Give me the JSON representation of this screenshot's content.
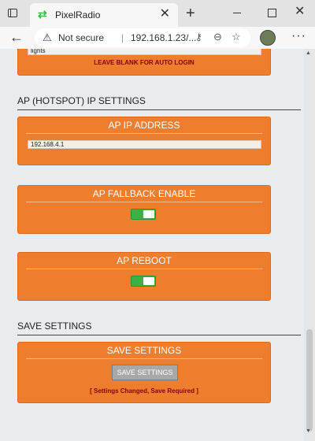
{
  "browser": {
    "tab_title": "PixelRadio",
    "tab_close": "✕",
    "new_tab": "+",
    "win_close": "✕",
    "not_secure": "Not secure",
    "url_sep": "|",
    "url": "192.168.1.23/...",
    "warning_glyph": "⚠",
    "favicon_glyph": "⇄",
    "back_glyph": "←",
    "key_glyph": "⚷",
    "zoom_glyph": "⊖",
    "fav_glyph": "☆",
    "menu_glyph": "···"
  },
  "login_card": {
    "input_value": "lights",
    "hint": "LEAVE BLANK FOR AUTO LOGIN"
  },
  "ap_section": {
    "heading": "AP (HOTSPOT) IP SETTINGS",
    "ip_card": {
      "title": "AP IP ADDRESS",
      "value": "192.168.4.1"
    },
    "fallback_card": {
      "title": "AP FALLBACK ENABLE",
      "enabled": true
    },
    "reboot_card": {
      "title": "AP REBOOT",
      "enabled": true
    }
  },
  "save_section": {
    "heading": "SAVE SETTINGS",
    "card_title": "SAVE SETTINGS",
    "button_label": "SAVE SETTINGS",
    "status": "[ Settings Changed, Save Required ]"
  },
  "scrollbar": {
    "up_glyph": "▲",
    "down_glyph": "▼"
  },
  "colors": {
    "card_orange": "#ee7e2e",
    "toggle_green": "#3cb043",
    "hint_red": "#8b0000"
  }
}
